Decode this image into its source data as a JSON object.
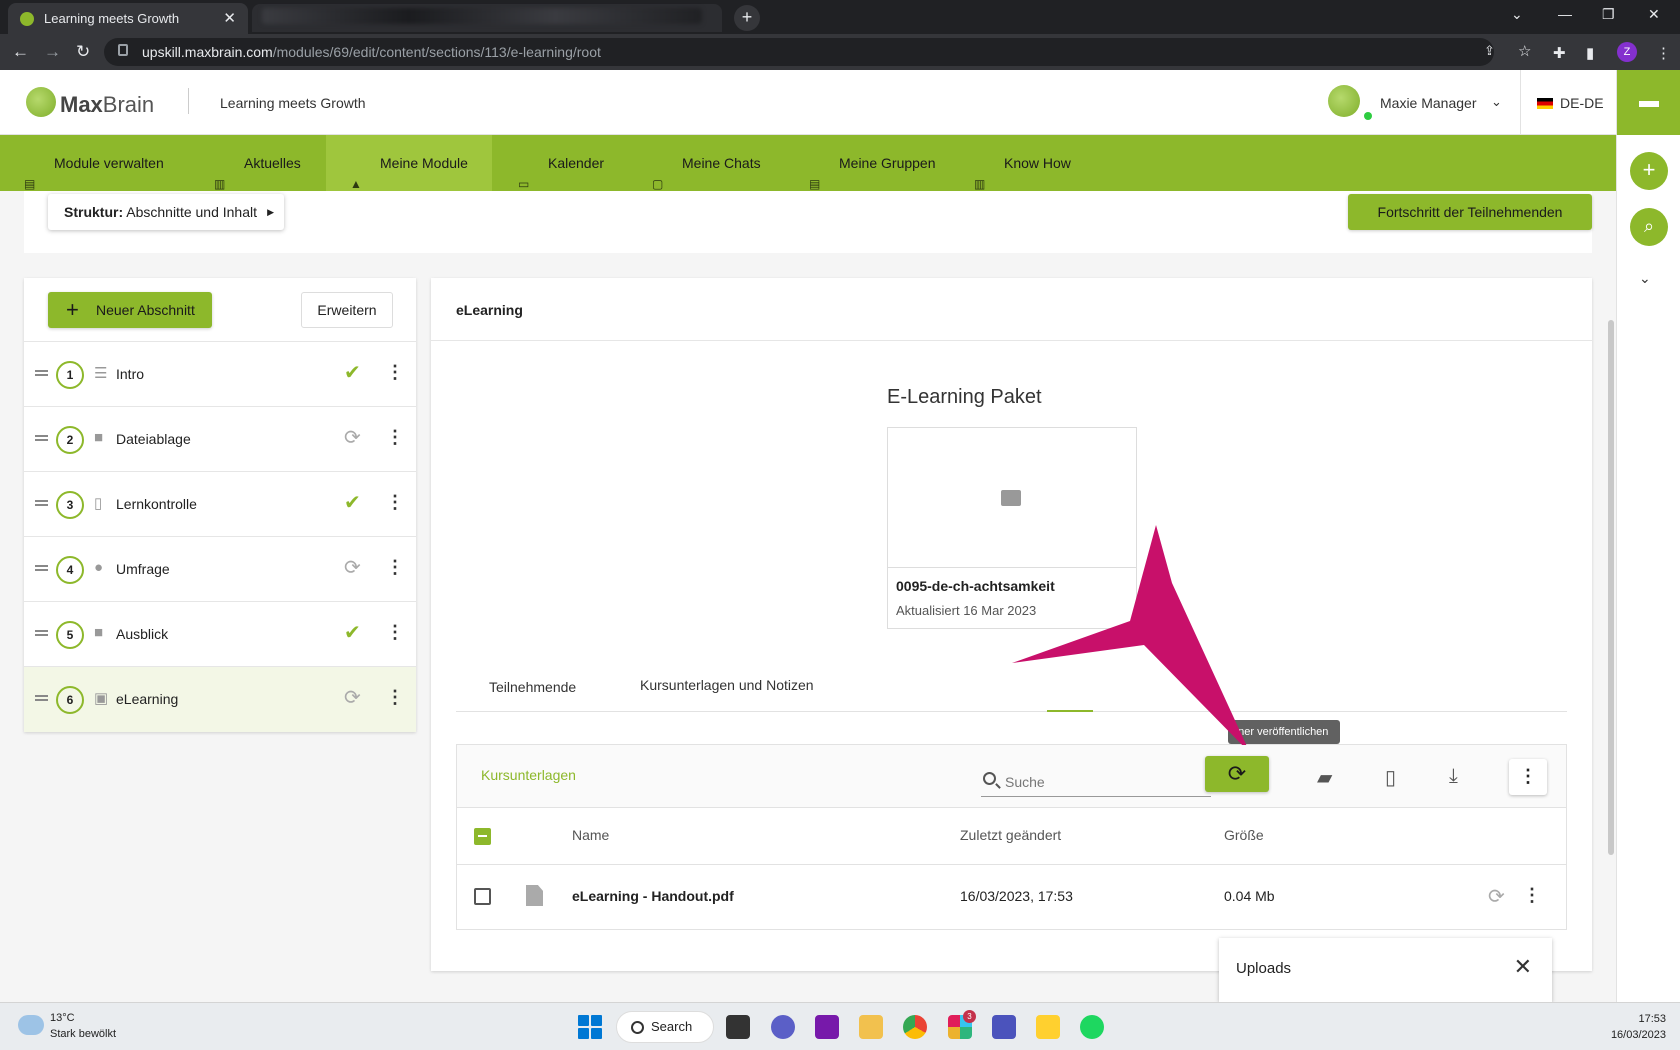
{
  "browser": {
    "tab_title": "Learning meets Growth",
    "url_host": "upskill.maxbrain.com",
    "url_path": "/modules/69/edit/content/sections/113/e-learning/root",
    "profile_initial": "Z"
  },
  "header": {
    "logo_bold": "Max",
    "logo_light": "Brain",
    "slogan": "Learning meets Growth",
    "user_name": "Maxie Manager",
    "language": "DE-DE"
  },
  "nav": {
    "items": [
      {
        "label": "Module verwalten"
      },
      {
        "label": "Aktuelles"
      },
      {
        "label": "Meine Module"
      },
      {
        "label": "Kalender"
      },
      {
        "label": "Meine Chats"
      },
      {
        "label": "Meine Gruppen"
      },
      {
        "label": "Know How"
      }
    ],
    "active_index": 2
  },
  "toolbar": {
    "struktur_label": "Struktur:",
    "struktur_value": "Abschnitte und Inhalt",
    "fortschritt_label": "Fortschritt der Teilnehmenden"
  },
  "sidebar": {
    "new_section_label": "Neuer Abschnitt",
    "expand_label": "Erweitern",
    "sections": [
      {
        "number": "1",
        "label": "Intro",
        "icon": "text-lines-icon",
        "status": "published"
      },
      {
        "number": "2",
        "label": "Dateiablage",
        "icon": "folder-icon",
        "status": "sync"
      },
      {
        "number": "3",
        "label": "Lernkontrolle",
        "icon": "quiz-icon",
        "status": "published"
      },
      {
        "number": "4",
        "label": "Umfrage",
        "icon": "survey-icon",
        "status": "sync"
      },
      {
        "number": "5",
        "label": "Ausblick",
        "icon": "folder-icon",
        "status": "published"
      },
      {
        "number": "6",
        "label": "eLearning",
        "icon": "monitor-icon",
        "status": "sync"
      }
    ],
    "selected_index": 5
  },
  "main": {
    "title": "eLearning",
    "package_heading": "E-Learning Paket",
    "package_name": "0095-de-ch-achtsamkeit",
    "package_updated": "Aktualisiert 16 Mar 2023",
    "tabs": [
      {
        "label": "Teilnehmende"
      },
      {
        "label": "Kursunterlagen und Notizen"
      }
    ],
    "active_tab": 1,
    "files": {
      "title": "Kursunterlagen",
      "search_placeholder": "Suche",
      "tooltip": "dner veröffentlichen",
      "columns": {
        "name": "Name",
        "modified": "Zuletzt geändert",
        "size": "Größe"
      },
      "rows": [
        {
          "name": "eLearning - Handout.pdf",
          "modified": "16/03/2023, 17:53",
          "size": "0.04 Mb"
        }
      ]
    }
  },
  "uploads": {
    "title": "Uploads"
  },
  "taskbar": {
    "temperature": "13°C",
    "weather": "Stark bewölkt",
    "search_label": "Search",
    "slack_badge": "3",
    "time": "17:53",
    "date": "16/03/2023"
  },
  "colors": {
    "brand_green": "#8db82b",
    "arrow_magenta": "#c8106a"
  }
}
